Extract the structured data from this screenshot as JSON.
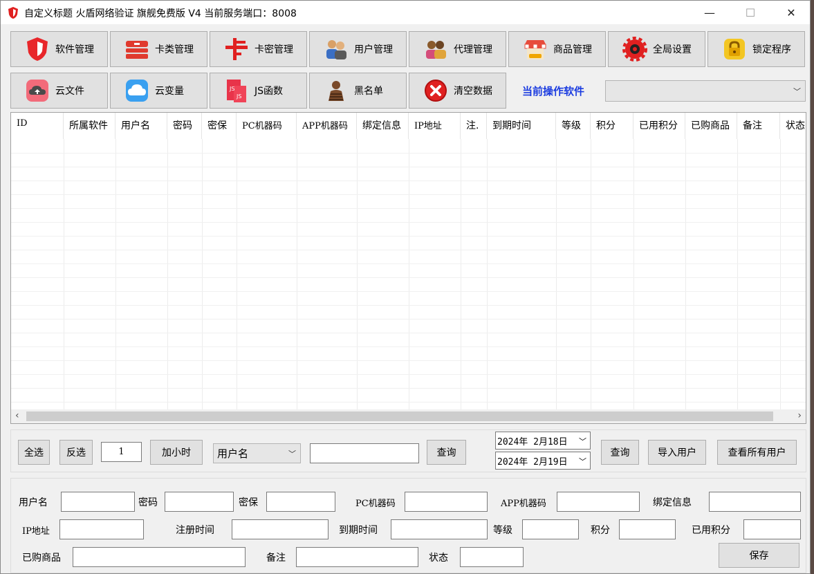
{
  "window": {
    "title": "自定义标题 火盾网络验证 旗舰免费版 V4    当前服务端口：8008",
    "minimize": "—",
    "maximize": "☐",
    "close": "✕"
  },
  "toolbar_row1": [
    {
      "label": "软件管理",
      "icon": "shield-icon"
    },
    {
      "label": "卡类管理",
      "icon": "card-stack-icon"
    },
    {
      "label": "卡密管理",
      "icon": "card-key-icon"
    },
    {
      "label": "用户管理",
      "icon": "users-icon"
    },
    {
      "label": "代理管理",
      "icon": "agents-icon"
    },
    {
      "label": "商品管理",
      "icon": "shop-icon"
    },
    {
      "label": "全局设置",
      "icon": "gear-icon"
    },
    {
      "label": "锁定程序",
      "icon": "lock-icon"
    }
  ],
  "toolbar_row2": [
    {
      "label": "云文件",
      "icon": "cloud-upload-icon"
    },
    {
      "label": "云变量",
      "icon": "cloud-icon"
    },
    {
      "label": "JS函数",
      "icon": "js-icon"
    },
    {
      "label": "黑名单",
      "icon": "blacklist-icon"
    },
    {
      "label": "清空数据",
      "icon": "clear-icon"
    }
  ],
  "current_software": {
    "label": "当前操作软件",
    "value": ""
  },
  "table": {
    "columns": [
      "ID",
      "所属软件",
      "用户名",
      "密码",
      "密保",
      "PC机器码",
      "APP机器码",
      "绑定信息",
      "IP地址",
      "注.",
      "到期时间",
      "等级",
      "积分",
      "已用积分",
      "已购商品",
      "备注",
      "状态"
    ],
    "rows": []
  },
  "search_bar": {
    "select_all": "全选",
    "invert": "反选",
    "hours_value": "1",
    "add_hours": "加小时",
    "field_select": "用户名",
    "keyword": "",
    "query1": "查询",
    "date_from": "2024年  2月18日",
    "date_to": "2024年  2月19日",
    "query2": "查询",
    "import_users": "导入用户",
    "view_all": "查看所有用户"
  },
  "edit_form": {
    "username": "用户名",
    "password": "密码",
    "security": "密保",
    "pc_code": "PC机器码",
    "app_code": "APP机器码",
    "bind_info": "绑定信息",
    "ip": "IP地址",
    "reg_time": "注册时间",
    "expire_time": "到期时间",
    "level": "等级",
    "points": "积分",
    "used_points": "已用积分",
    "bought": "已购商品",
    "note": "备注",
    "status": "状态",
    "save": "保存"
  }
}
